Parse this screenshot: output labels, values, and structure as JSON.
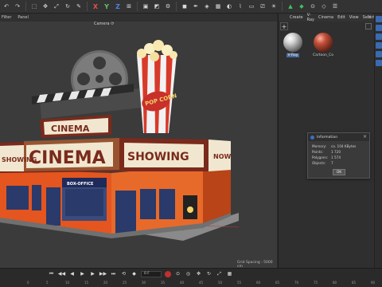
{
  "viewport": {
    "menu": [
      "Filter",
      "Panel"
    ],
    "camera_label": "Camera",
    "grid_spacing": "Grid Spacing : 5000 cm"
  },
  "material_manager": {
    "menu": [
      "Create",
      "V-Ray",
      "Cinema",
      "Edit",
      "View",
      "Select"
    ],
    "materials": [
      {
        "name": "V-Ray",
        "selected": true
      },
      {
        "name": "Cartoon_Co",
        "selected": false
      }
    ]
  },
  "info_dialog": {
    "title": "Information",
    "rows": [
      {
        "key": "Memory:",
        "value": "ca. 104 KBytes"
      },
      {
        "key": "Points:",
        "value": "1 720"
      },
      {
        "key": "Polygons:",
        "value": "1 574"
      },
      {
        "key": "Objects:",
        "value": "7"
      }
    ],
    "ok_label": "OK"
  },
  "scene": {
    "marquee_top": "CINEMA",
    "marquee_main": "CINEMA",
    "sign_showing": "SHOWING",
    "sign_side_left": "SHOWING",
    "sign_side_right": "NOW",
    "popcorn": "POP CORN",
    "box_office": "BOX-OFFICE"
  },
  "timeline": {
    "frame": "0 F",
    "ticks": [
      "0",
      "5",
      "10",
      "15",
      "20",
      "25",
      "30",
      "35",
      "40",
      "45",
      "50",
      "55",
      "60",
      "65",
      "70",
      "75",
      "80",
      "85",
      "90"
    ]
  },
  "colors": {
    "accent_blue": "#3a70c0",
    "building_orange": "#e5551f",
    "marquee_maroon": "#7a2a1c",
    "bulb_yellow": "#f5d36a"
  }
}
